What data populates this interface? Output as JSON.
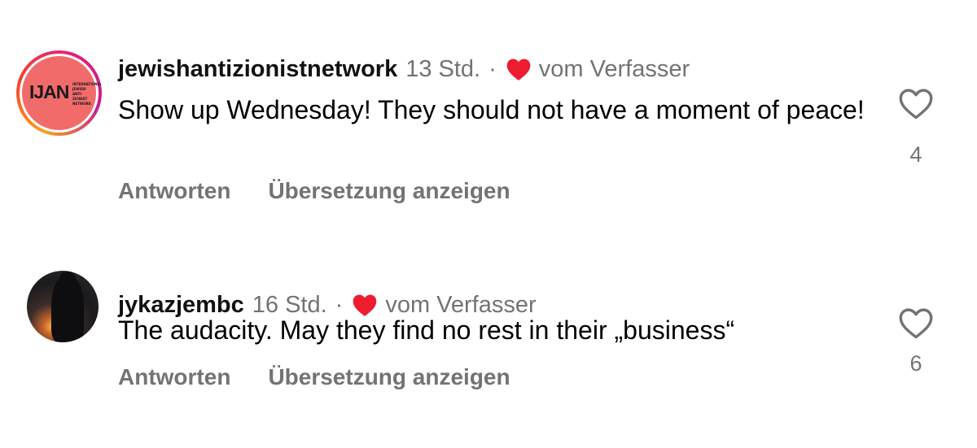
{
  "comments": [
    {
      "username": "jewishantizionistnetwork",
      "time": "13 Std.",
      "separator": "·",
      "author_like_label": "vom Verfasser",
      "text": "Show up Wednesday! They should not have a moment of peace!",
      "reply_label": "Antworten",
      "translate_label": "Übersetzung anzeigen",
      "like_count": "4",
      "avatar": {
        "type": "logo",
        "logo_text": "IJAN",
        "logo_subtext": "INTERNATIONAL JEWISH ANTI-ZIONIST NETWORK",
        "background": "#f26b6b",
        "story_ring": true
      }
    },
    {
      "username": "jykazjembc",
      "time": "16 Std.",
      "separator": "·",
      "author_like_label": "vom Verfasser",
      "text": "The audacity. May they find no rest in their „business“",
      "reply_label": "Antworten",
      "translate_label": "Übersetzung anzeigen",
      "like_count": "6",
      "avatar": {
        "type": "photo",
        "description": "silhouette-at-sunset"
      }
    }
  ],
  "icons": {
    "author_heart": "heart-filled-icon",
    "like": "heart-outline-icon"
  },
  "colors": {
    "author_heart": "#ed1c2e",
    "secondary_text": "#737373",
    "primary_text": "#000000"
  }
}
